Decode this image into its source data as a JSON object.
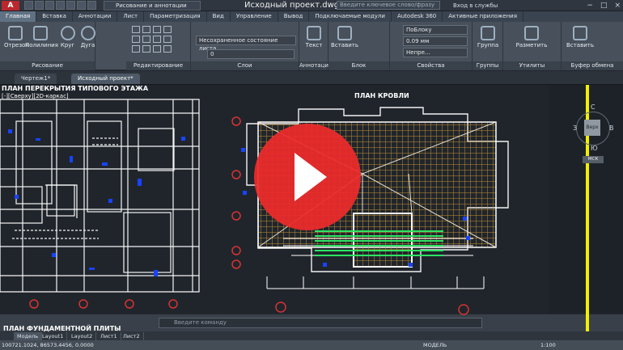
{
  "window": {
    "logo": "A",
    "workspace": "Рисование и аннотации",
    "title": "Исходный проект.dwg",
    "search_placeholder": "Введите ключевое слово/фразу",
    "login": "Вход в службы"
  },
  "ribbon_tabs": [
    "Главная",
    "Вставка",
    "Аннотации",
    "Лист",
    "Параметризация",
    "Вид",
    "Управление",
    "Вывод",
    "Подключаемые модули",
    "Autodesk 360",
    "Активные приложения"
  ],
  "ribbon": {
    "draw_tools": [
      "Отрезок",
      "Полилиния",
      "Круг",
      "Дуга"
    ],
    "panels": [
      "Рисование",
      "Редактирование",
      "Слои",
      "Аннотации",
      "Блок",
      "Свойства",
      "Группы",
      "Утилиты",
      "Буфер обмена"
    ],
    "layer_state": "Несохраненное состояние листа",
    "layer_value": "0",
    "text": "Текст",
    "insert": "Вставить",
    "bylayer": "ПоБлоку",
    "lineweight": "0.09 мм",
    "linetype": "Непре...",
    "group": "Группа",
    "measure": "Разметить",
    "paste": "Вставить"
  },
  "file_tabs": [
    "Чертеж1*",
    "Исходный проект*"
  ],
  "canvas": {
    "left_title": "ПЛАН ПЕРЕКРЫТИЯ ТИПОВОГО ЭТАЖА",
    "viewport_label": "[-][Сверху][2D-каркас]",
    "center_title": "ПЛАН КРОВЛИ",
    "bottom_title": "ПЛАН ФУНДАМЕНТНОЙ ПЛИТЫ"
  },
  "viewcube": {
    "north": "С",
    "south": "Ю",
    "west": "З",
    "east": "В",
    "face": "Верх",
    "ucs": "МСК"
  },
  "command": {
    "placeholder": "Введите команду"
  },
  "layout_tabs": [
    "Модель",
    "Layout1",
    "Layout2",
    "Лист1",
    "Лист2"
  ],
  "status": {
    "coords": "100721.1024, 86573.4456, 0.0000",
    "model": "МОДЕЛЬ",
    "scale": "1:100"
  },
  "colors": {
    "accent": "#ed2b2b",
    "highlight": "#f1f000",
    "drawing_orange": "#d29a2e"
  },
  "icons": [
    "app-logo-icon",
    "play-icon",
    "line-icon",
    "polyline-icon",
    "circle-icon",
    "arc-icon",
    "viewcube-icon"
  ]
}
